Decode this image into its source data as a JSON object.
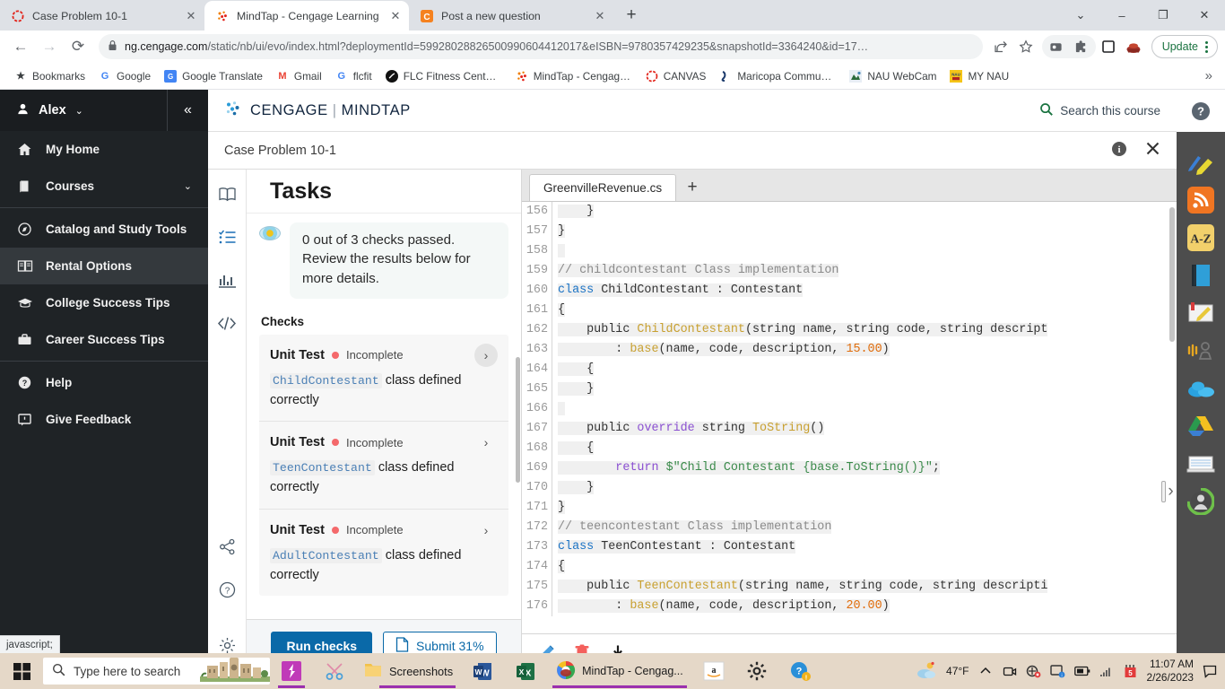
{
  "browser": {
    "tabs": [
      {
        "title": "Case Problem 10-1",
        "favicon": "cengage-icon",
        "active": false
      },
      {
        "title": "MindTap - Cengage Learning",
        "favicon": "mindtap-icon",
        "active": true
      },
      {
        "title": "Post a new question",
        "favicon": "chegg-icon",
        "active": false
      }
    ],
    "new_tab_label": "+",
    "window_controls": [
      "chevron-down",
      "minimize",
      "maximize",
      "close"
    ],
    "nav": {
      "back": "←",
      "forward": "→",
      "reload": "↻"
    },
    "omnibox": {
      "lock": "lock-icon",
      "url_host": "ng.cengage.com",
      "url_path": "/static/nb/ui/evo/index.html?deploymentId=59928028826500990604412017&eISBN=9780357429235&snapshotId=3364240&id=17…"
    },
    "toolbar_icons": [
      "share-icon",
      "bookmark-star-icon",
      "media-icon",
      "extensions-icon",
      "sidepanel-icon",
      "profile-avatar-icon"
    ],
    "update_label": "Update",
    "bookmarks": [
      {
        "label": "Bookmarks",
        "icon": "star-icon"
      },
      {
        "label": "Google",
        "icon": "google-icon"
      },
      {
        "label": "Google Translate",
        "icon": "translate-icon"
      },
      {
        "label": "Gmail",
        "icon": "gmail-icon"
      },
      {
        "label": "flcfit",
        "icon": "google-icon"
      },
      {
        "label": "FLC Fitness Center -…",
        "icon": "flc-icon"
      },
      {
        "label": "MindTap - Cengage…",
        "icon": "mindtap-icon"
      },
      {
        "label": "CANVAS",
        "icon": "canvas-icon"
      },
      {
        "label": "Maricopa Commun…",
        "icon": "maricopa-icon"
      },
      {
        "label": "NAU WebCam",
        "icon": "nau-icon"
      },
      {
        "label": "MY NAU",
        "icon": "mynau-icon"
      }
    ],
    "bookmarks_overflow": "»"
  },
  "sidebar": {
    "user": {
      "name": "Alex",
      "caret": "⌄"
    },
    "collapse_icon": "«",
    "items": [
      {
        "label": "My Home",
        "icon": "home-icon",
        "active": false,
        "has_chevron": false
      },
      {
        "label": "Courses",
        "icon": "book-icon",
        "active": false,
        "has_chevron": true
      },
      {
        "label": "Catalog and Study Tools",
        "icon": "compass-icon",
        "active": false,
        "has_chevron": false
      },
      {
        "label": "Rental Options",
        "icon": "open-book-icon",
        "active": true,
        "has_chevron": false
      },
      {
        "label": "College Success Tips",
        "icon": "graduation-cap-icon",
        "active": false,
        "has_chevron": false
      },
      {
        "label": "Career Success Tips",
        "icon": "briefcase-icon",
        "active": false,
        "has_chevron": false
      },
      {
        "label": "Help",
        "icon": "question-circle-icon",
        "active": false,
        "has_chevron": false
      },
      {
        "label": "Give Feedback",
        "icon": "feedback-icon",
        "active": false,
        "has_chevron": false
      }
    ]
  },
  "mindtap": {
    "brand": "CENGAGE",
    "brand_divider": "|",
    "product": "MINDTAP",
    "search_placeholder": "Search this course",
    "breadcrumb": "Case Problem 10-1",
    "info_icon": "info-icon",
    "close_icon": "close-icon",
    "icon_rail": [
      {
        "name": "book-icon",
        "active": false
      },
      {
        "name": "checklist-icon",
        "active": true
      },
      {
        "name": "chart-icon",
        "active": false
      },
      {
        "name": "code-icon",
        "active": false
      },
      {
        "name": "share-icon",
        "active": false
      },
      {
        "name": "help-icon",
        "active": false
      },
      {
        "name": "settings-icon",
        "active": false
      }
    ]
  },
  "tasks": {
    "title": "Tasks",
    "result_message": "0 out of 3 checks passed. Review the results below for more details.",
    "checks_label": "Checks",
    "checks": [
      {
        "name": "Unit Test",
        "status": "Incomplete",
        "code": "ChildContestant",
        "description_suffix": "class defined correctly",
        "highlighted": true
      },
      {
        "name": "Unit Test",
        "status": "Incomplete",
        "code": "TeenContestant",
        "description_suffix": "class defined correctly",
        "highlighted": false
      },
      {
        "name": "Unit Test",
        "status": "Incomplete",
        "code": "AdultContestant",
        "description_suffix": "class defined correctly",
        "highlighted": false
      }
    ],
    "run_button": "Run checks",
    "submit_button": "Submit 31%",
    "submit_icon": "document-icon"
  },
  "editor": {
    "tab_name": "GreenvilleRevenue.cs",
    "add_tab": "+",
    "footer_icons": [
      "edit-pencil-icon",
      "delete-trash-icon",
      "download-icon"
    ],
    "expander_icon": "›",
    "lines": [
      {
        "n": "156",
        "html": "<span class=\"hl\">    }</span>"
      },
      {
        "n": "157",
        "html": "<span class=\"hl\">}</span>"
      },
      {
        "n": "158",
        "html": "<span class=\"hl\"> </span>"
      },
      {
        "n": "159",
        "html": "<span class=\"hl cmt\">// childcontestant Class implementation</span>"
      },
      {
        "n": "160",
        "html": "<span class=\"hl\"><span class=\"kw\">class</span> ChildContestant : Contestant</span>"
      },
      {
        "n": "161",
        "html": "<span class=\"hl\">{</span>"
      },
      {
        "n": "162",
        "html": "<span class=\"hl\">    public <span class=\"typ\">ChildContestant</span>(string name, string code, string descript</span>"
      },
      {
        "n": "163",
        "html": "<span class=\"hl\">        : <span class=\"typ\">base</span>(name, code, description, <span class=\"num\">15.00</span>)</span>"
      },
      {
        "n": "164",
        "html": "<span class=\"hl\">    {</span>"
      },
      {
        "n": "165",
        "html": "<span class=\"hl\">    }</span>"
      },
      {
        "n": "166",
        "html": "<span class=\"hl\"> </span>"
      },
      {
        "n": "167",
        "html": "<span class=\"hl\">    public <span class=\"kw2\">override</span> string <span class=\"typ\">ToString</span>()</span>"
      },
      {
        "n": "168",
        "html": "<span class=\"hl\">    {</span>"
      },
      {
        "n": "169",
        "html": "<span class=\"hl\">        <span class=\"kw2\">return</span> <span class=\"str\">$\"Child Contestant {base.ToString()}\"</span>;</span>"
      },
      {
        "n": "170",
        "html": "<span class=\"hl\">    }</span>"
      },
      {
        "n": "171",
        "html": "<span class=\"hl\">}</span>"
      },
      {
        "n": "172",
        "html": "<span class=\"hl cmt\">// teencontestant Class implementation</span>"
      },
      {
        "n": "173",
        "html": "<span class=\"hl\"><span class=\"kw\">class</span> TeenContestant : Contestant</span>"
      },
      {
        "n": "174",
        "html": "<span class=\"hl\">{</span>"
      },
      {
        "n": "175",
        "html": "<span class=\"hl\">    public <span class=\"typ\">TeenContestant</span>(string name, string code, string descripti</span>"
      },
      {
        "n": "176",
        "html": "<span class=\"hl\">        : <span class=\"typ\">base</span>(name, code, description, <span class=\"num\">20.00</span>)</span>"
      }
    ]
  },
  "right_rail": [
    {
      "name": "help-icon"
    },
    {
      "name": "highlighter-pen-icon"
    },
    {
      "name": "rss-feed-icon"
    },
    {
      "name": "dictionary-az-icon"
    },
    {
      "name": "ebook-icon"
    },
    {
      "name": "notebook-icon"
    },
    {
      "name": "read-aloud-icon"
    },
    {
      "name": "onedrive-icon"
    },
    {
      "name": "google-drive-icon"
    },
    {
      "name": "flashcards-icon"
    },
    {
      "name": "profile-avatar-icon"
    }
  ],
  "status_bar": {
    "text": "javascript;"
  },
  "taskbar": {
    "search_placeholder": "Type here to search",
    "apps": [
      {
        "name": "sketch-app-icon",
        "label": ""
      },
      {
        "name": "snip-tool-icon",
        "label": ""
      },
      {
        "name": "file-explorer-screenshots",
        "label": "Screenshots"
      },
      {
        "name": "word-icon",
        "label": ""
      },
      {
        "name": "excel-icon",
        "label": ""
      },
      {
        "name": "chrome-mindtap",
        "label": "MindTap - Cengag..."
      },
      {
        "name": "amazon-icon",
        "label": ""
      },
      {
        "name": "settings-gear-icon",
        "label": ""
      },
      {
        "name": "help-blue-icon",
        "label": ""
      }
    ],
    "weather": "47°F",
    "tray_chevron": "⌃",
    "tray_icons": [
      "camera-icon",
      "antivirus-icon",
      "display-icon",
      "battery-icon",
      "wifi-icon",
      "calendar-red-icon"
    ],
    "time": "11:07 AM",
    "date": "2/26/2023",
    "notifications_icon": "notification-icon"
  }
}
